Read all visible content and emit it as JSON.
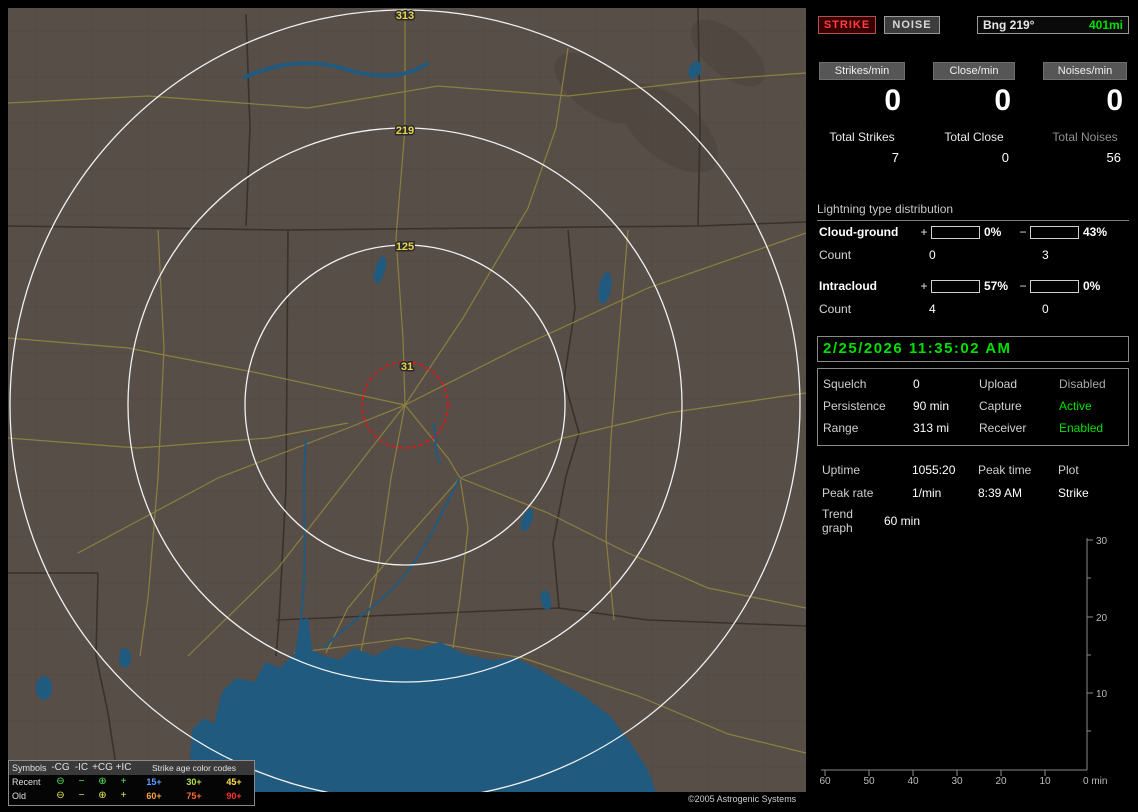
{
  "theme": {
    "green": "#00e000",
    "bar_blue": "#7fb2e8",
    "bar_pink": "#f468a8"
  },
  "map": {
    "range_labels": [
      "313",
      "219",
      "125",
      "31"
    ],
    "copyright": "©2005 Astrogenic Systems",
    "legend": {
      "symbols_title": "Symbols",
      "col_headers": [
        "-CG",
        "-IC",
        "+CG",
        "+IC"
      ],
      "symbol_glyphs": [
        "⊖",
        "−",
        "⊕",
        "+"
      ],
      "age_title": "Strike age color codes",
      "rows": [
        {
          "label": "Recent",
          "symbol_color": "#58e858",
          "ages": [
            "15+",
            "30+",
            "45+"
          ],
          "age_colors": [
            "#5f9fff",
            "#b8e04a",
            "#ffe04a"
          ]
        },
        {
          "label": "Old",
          "symbol_color": "#e8e858",
          "ages": [
            "60+",
            "75+",
            "90+"
          ],
          "age_colors": [
            "#ffa040",
            "#ff6a3a",
            "#ff3030"
          ]
        }
      ]
    }
  },
  "panel": {
    "mode_buttons": {
      "strike": "STRIKE",
      "noise": "NOISE"
    },
    "bearing": {
      "label": "Bng 219°",
      "range": "401mi"
    },
    "rates": [
      {
        "label": "Strikes/min",
        "value": "0",
        "total_label": "Total Strikes",
        "total_value": "7",
        "total_label_color": "#e8e8e8"
      },
      {
        "label": "Close/min",
        "value": "0",
        "total_label": "Total Close",
        "total_value": "0",
        "total_label_color": "#e8e8e8"
      },
      {
        "label": "Noises/min",
        "value": "0",
        "total_label": "Total Noises",
        "total_value": "56",
        "total_label_color": "#909090"
      }
    ],
    "distribution": {
      "title": "Lightning type distribution",
      "pos_sign": "+",
      "neg_sign": "−",
      "count_label": "Count",
      "rows": [
        {
          "name": "Cloud-ground",
          "pos": {
            "pct": "0%",
            "count": "0",
            "color": "#f468a8"
          },
          "neg": {
            "pct": "43%",
            "count": "3",
            "color": "#7fb2e8"
          }
        },
        {
          "name": "Intracloud",
          "pos": {
            "pct": "57%",
            "count": "4",
            "color": "#f468a8"
          },
          "neg": {
            "pct": "0%",
            "count": "0",
            "color": "#7fb2e8"
          }
        }
      ]
    },
    "datetime": "2/25/2026 11:35:02 AM",
    "settings": [
      {
        "label": "Squelch",
        "value": "0",
        "label2": "Upload",
        "value2": "Disabled",
        "value2_color": "#a8a8a8"
      },
      {
        "label": "Persistence",
        "value": "90 min",
        "label2": "Capture",
        "value2": "Active",
        "value2_color": "#00e000"
      },
      {
        "label": "Range",
        "value": "313 mi",
        "label2": "Receiver",
        "value2": "Enabled",
        "value2_color": "#00e000"
      }
    ],
    "stats": {
      "r1c1": "Uptime",
      "r1c2": "1055:20",
      "r1c3": "Peak time",
      "r1c4": "Plot",
      "r2c1": "Peak rate",
      "r2c2": "1/min",
      "r2c3": "8:39 AM",
      "r2c4": "Strike",
      "trend_label": "Trend graph",
      "trend_value": "60 min"
    },
    "trend_graph": {
      "y_ticks": [
        "30",
        "20",
        "10"
      ],
      "x_ticks": [
        "60",
        "50",
        "40",
        "30",
        "20",
        "10"
      ],
      "x_end": "0 min"
    }
  }
}
